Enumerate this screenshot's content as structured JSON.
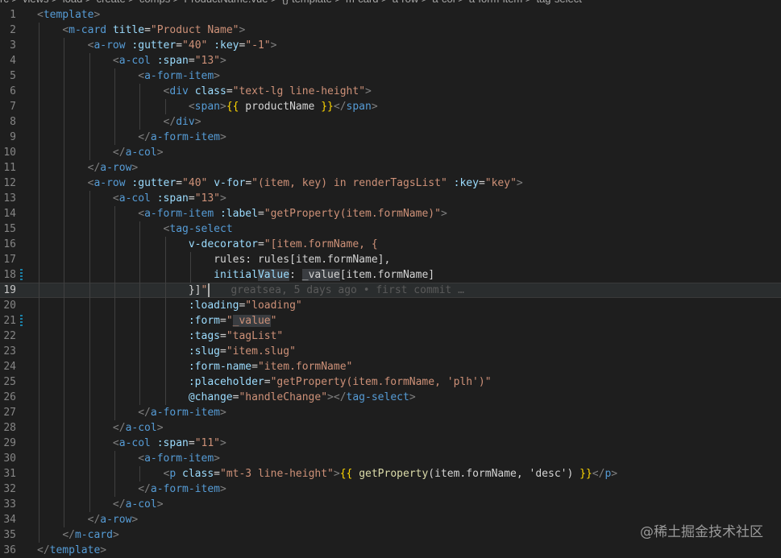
{
  "breadcrumb": [
    "rc",
    "views",
    "load",
    "create",
    "comps",
    "ProductName.vue",
    "{} template",
    "m-card",
    "a-row",
    "a-col",
    "a-form-item",
    "tag-select"
  ],
  "current_line": 19,
  "line_numbers": [
    "1",
    "2",
    "3",
    "4",
    "5",
    "6",
    "7",
    "8",
    "9",
    "10",
    "11",
    "12",
    "13",
    "14",
    "15",
    "16",
    "17",
    "18",
    "19",
    "20",
    "21",
    "22",
    "23",
    "24",
    "25",
    "26",
    "27",
    "28",
    "29",
    "30",
    "31",
    "32",
    "33",
    "34",
    "35",
    "36"
  ],
  "lines": [
    "<template>",
    "  <m-card title=\"Product Name\">",
    "    <a-row :gutter=\"40\" :key=\"-1\">",
    "      <a-col :span=\"13\">",
    "        <a-form-item>",
    "          <div class=\"text-lg line-height\">",
    "            <span>{{ productName }}</span>",
    "          </div>",
    "        </a-form-item>",
    "      </a-col>",
    "    </a-row>",
    "    <a-row :gutter=\"40\" v-for=\"(item, key) in renderTagsList\" :key=\"key\">",
    "      <a-col :span=\"13\">",
    "        <a-form-item :label=\"getProperty(item.formName)\">",
    "          <tag-select",
    "            v-decorator=\"[item.formName, {",
    "              rules: rules[item.formName],",
    "              initialValue: _value[item.formName]",
    "            }]\"",
    "            :loading=\"loading\"",
    "            :form=\"_value\"",
    "            :tags=\"tagList\"",
    "            :slug=\"item.slug\"",
    "            :form-name=\"item.formName\"",
    "            :placeholder=\"getProperty(item.formName, 'plh')\"",
    "            @change=\"handleChange\"></tag-select>",
    "        </a-form-item>",
    "      </a-col>",
    "      <a-col :span=\"11\">",
    "        <a-form-item>",
    "          <p class=\"mt-3 line-height\">{{ getProperty(item.formName, 'desc') }}</p>",
    "        </a-form-item>",
    "      </a-col>",
    "    </a-row>",
    "  </m-card>",
    "</template>"
  ],
  "blame": "greatsea, 5 days ago • first commit …",
  "watermark": "@稀土掘金技术社区",
  "colors": {
    "background": "#1e1e1e",
    "tag_bracket": "#808080",
    "tag_name": "#569cd6",
    "attribute": "#9cdcfe",
    "string": "#ce9178",
    "function": "#dcdcaa",
    "mustache": "#ffd700"
  }
}
